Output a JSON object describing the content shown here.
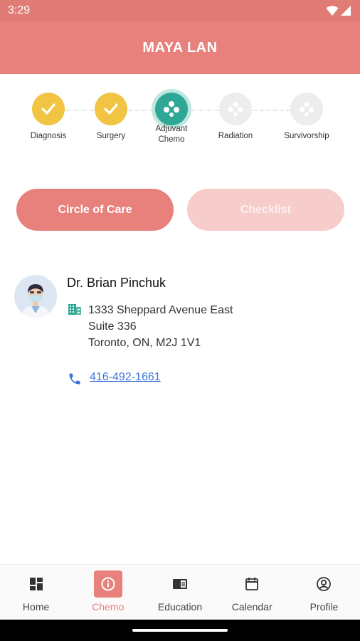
{
  "status": {
    "time": "3:29"
  },
  "header": {
    "title": "MAYA LAN"
  },
  "stepper": {
    "steps": [
      {
        "label": "Diagnosis",
        "state": "done",
        "icon": "check-icon"
      },
      {
        "label": "Surgery",
        "state": "done",
        "icon": "check-icon"
      },
      {
        "label": "Adjuvant\nChemo",
        "state": "active",
        "icon": "molecule-icon"
      },
      {
        "label": "Radiation",
        "state": "todo",
        "icon": "molecule-icon"
      },
      {
        "label": "Survivorship",
        "state": "todo",
        "icon": "molecule-icon"
      }
    ]
  },
  "buttons": {
    "circle_of_care": "Circle of Care",
    "checklist": "Checklist"
  },
  "doctor": {
    "name": "Dr. Brian Pinchuk",
    "address_line1": "1333 Sheppard Avenue East",
    "address_line2": "Suite 336",
    "address_line3": "Toronto, ON, M2J 1V1",
    "phone": "416-492-1661"
  },
  "nav": {
    "items": [
      {
        "label": "Home",
        "icon": "dashboard-icon"
      },
      {
        "label": "Chemo",
        "icon": "info-icon",
        "active": true
      },
      {
        "label": "Education",
        "icon": "book-icon"
      },
      {
        "label": "Calendar",
        "icon": "calendar-icon"
      },
      {
        "label": "Profile",
        "icon": "profile-icon"
      }
    ]
  },
  "colors": {
    "primary": "#e8807b",
    "done": "#f2c443",
    "active": "#2ea895",
    "link": "#3b73d9"
  }
}
